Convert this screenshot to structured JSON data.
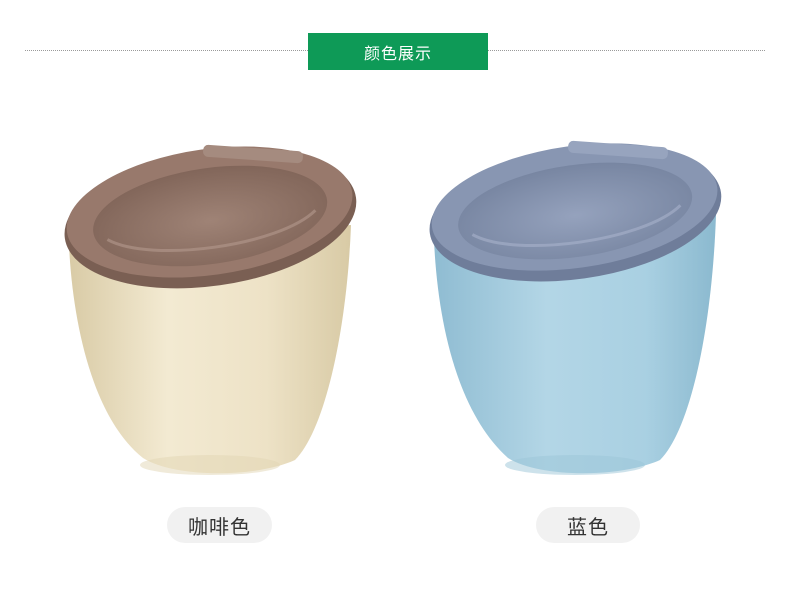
{
  "header": {
    "title": "颜色展示",
    "banner_color": "#0e9a57"
  },
  "products": [
    {
      "name": "咖啡色",
      "lid_color": "#92756a",
      "body_color": "#ece0c3"
    },
    {
      "name": "蓝色",
      "lid_color": "#8391ad",
      "body_color": "#a6cde0"
    }
  ],
  "icons": [
    "trash-bin-coffee-image",
    "trash-bin-blue-image"
  ]
}
